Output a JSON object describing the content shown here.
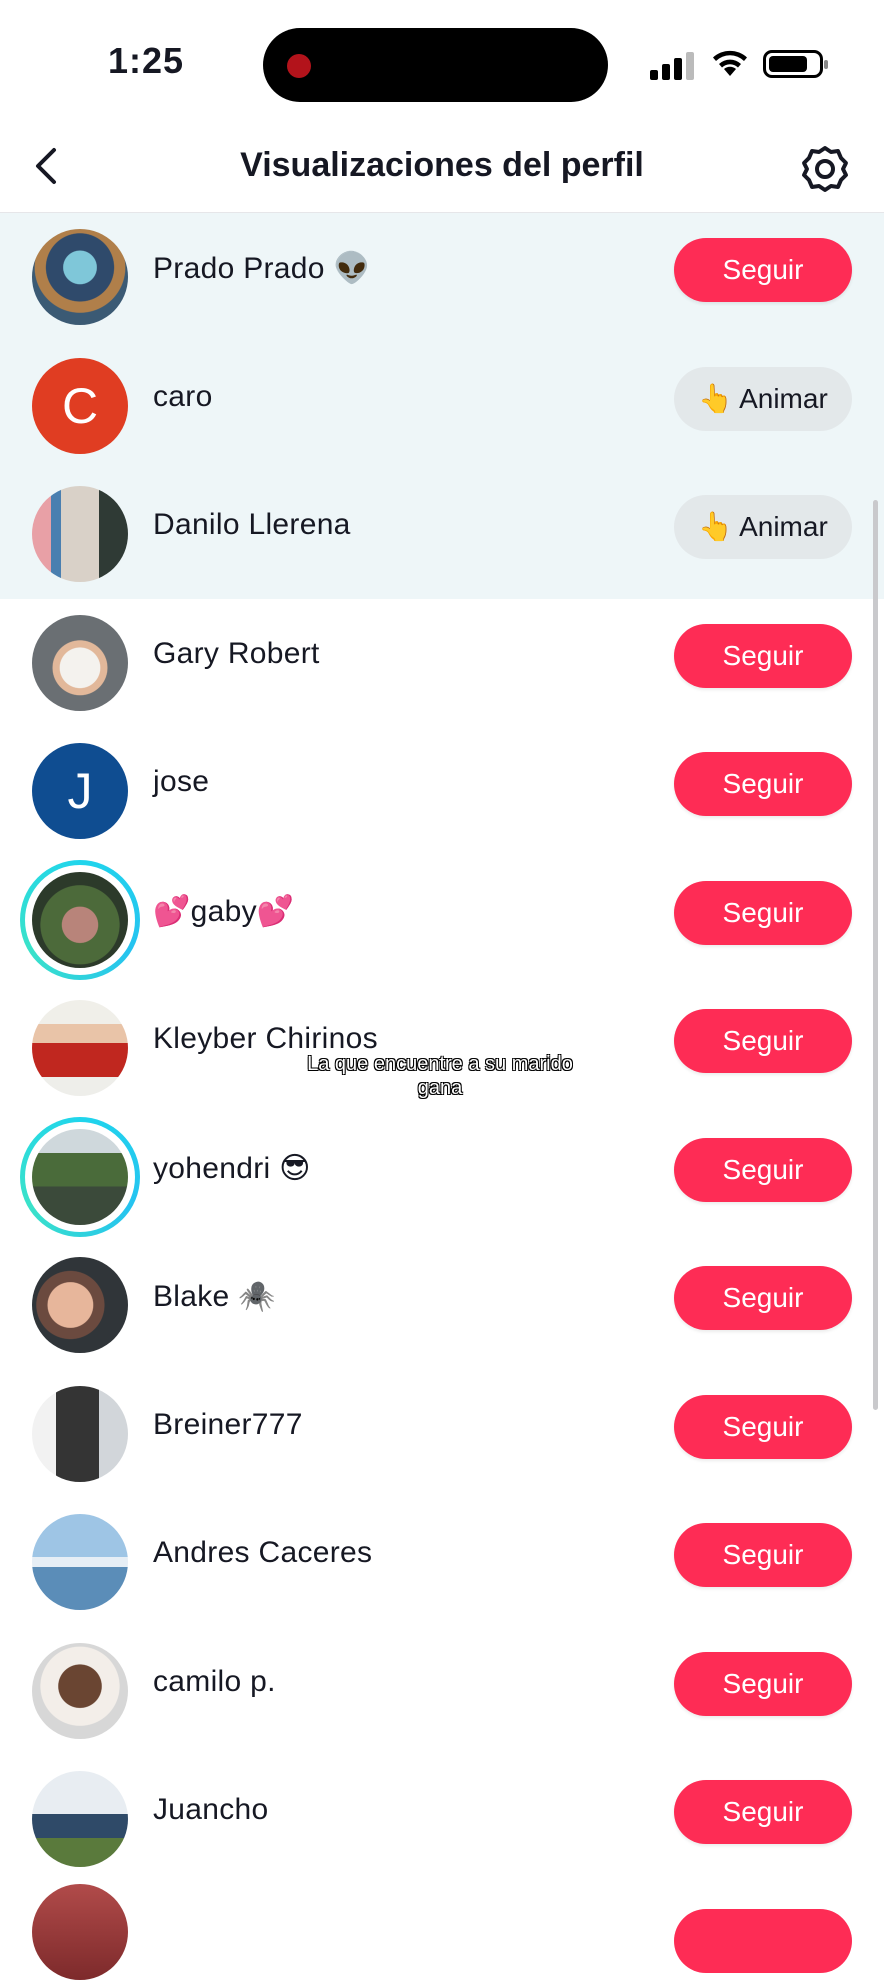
{
  "status_bar": {
    "time": "1:25"
  },
  "header": {
    "title": "Visualizaciones del perfil"
  },
  "rows": [
    {
      "name": "Prado Prado 👽",
      "button": "Seguir",
      "button_type": "follow",
      "highlight": true,
      "avatar": "photo-group"
    },
    {
      "name": "caro",
      "button": "Animar",
      "button_type": "animar",
      "highlight": true,
      "avatar": "letter",
      "letter": "C",
      "avatar_color": "#e03d22"
    },
    {
      "name": "Danilo Llerena",
      "button": "Animar",
      "button_type": "animar",
      "highlight": true,
      "avatar": "photo-man-store"
    },
    {
      "name": "Gary Robert",
      "button": "Seguir",
      "button_type": "follow",
      "highlight": false,
      "avatar": "photo-beard"
    },
    {
      "name": "jose",
      "button": "Seguir",
      "button_type": "follow",
      "highlight": false,
      "avatar": "letter",
      "letter": "J",
      "avatar_color": "#0f4d91"
    },
    {
      "name": "💕gaby💕",
      "button": "Seguir",
      "button_type": "follow",
      "highlight": false,
      "avatar": "photo-group-ring",
      "story_ring": true
    },
    {
      "name": "Kleyber Chirinos",
      "button": "Seguir",
      "button_type": "follow",
      "highlight": false,
      "avatar": "photo-selfie-red"
    },
    {
      "name": "yohendri 😎",
      "button": "Seguir",
      "button_type": "follow",
      "highlight": false,
      "avatar": "photo-trees",
      "story_ring": true
    },
    {
      "name": "Blake 🕷️",
      "button": "Seguir",
      "button_type": "follow",
      "highlight": false,
      "avatar": "photo-couple"
    },
    {
      "name": "Breiner777",
      "button": "Seguir",
      "button_type": "follow",
      "highlight": false,
      "avatar": "photo-mirror"
    },
    {
      "name": "Andres Caceres",
      "button": "Seguir",
      "button_type": "follow",
      "highlight": false,
      "avatar": "photo-harbor"
    },
    {
      "name": "camilo p.",
      "button": "Seguir",
      "button_type": "follow",
      "highlight": false,
      "avatar": "photo-face"
    },
    {
      "name": "Juancho",
      "button": "Seguir",
      "button_type": "follow",
      "highlight": false,
      "avatar": "photo-field"
    }
  ],
  "caption": "La que encuentre a su marido gana",
  "colors": {
    "follow": "#fe2c55",
    "animar_bg": "#e3e8ea",
    "highlight_bg": "#eef6f8",
    "story_ring": "#20d5ec"
  },
  "icons": {
    "back": "chevron-left-icon",
    "settings": "gear-icon",
    "animar": "pointing-hand-icon"
  }
}
